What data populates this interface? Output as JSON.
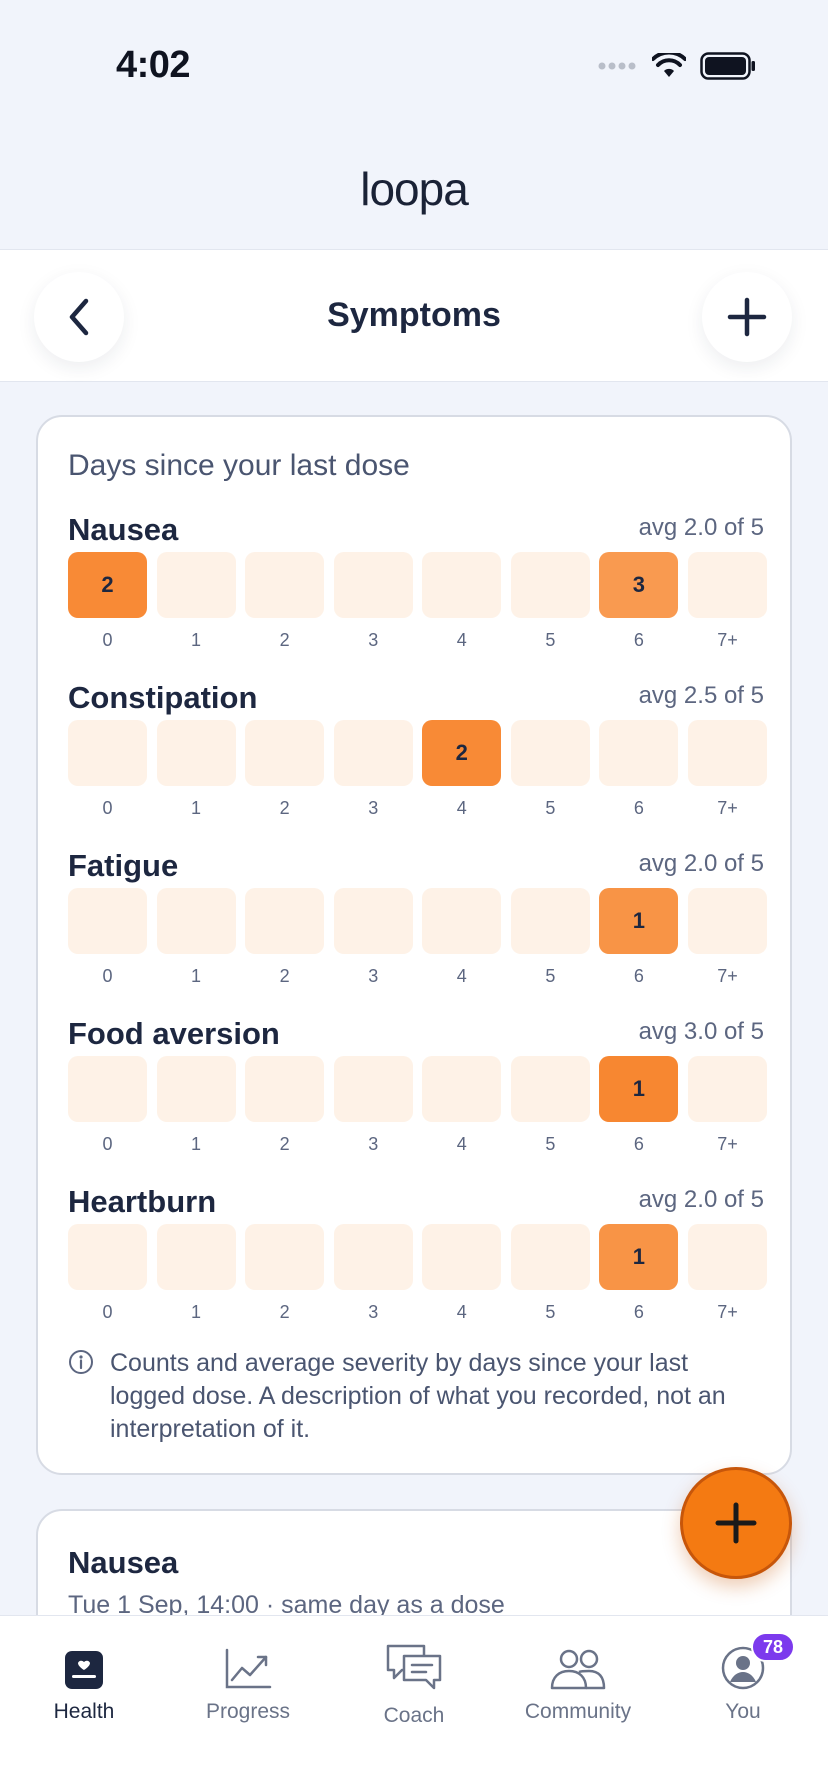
{
  "status_bar": {
    "time": "4:02"
  },
  "app": {
    "logo_text": "loopa"
  },
  "nav": {
    "title": "Symptoms"
  },
  "summary": {
    "title": "Days since your last dose",
    "day_labels": [
      "0",
      "1",
      "2",
      "3",
      "4",
      "5",
      "6",
      "7+"
    ],
    "symptoms": [
      {
        "name": "Nausea",
        "avg": "avg 2.0 of 5",
        "counts": [
          "2",
          "",
          "",
          "",
          "",
          "",
          "3",
          ""
        ],
        "intensity": [
          0.85,
          0,
          0,
          0,
          0,
          0,
          0.6,
          0
        ]
      },
      {
        "name": "Constipation",
        "avg": "avg 2.5 of 5",
        "counts": [
          "",
          "",
          "",
          "",
          "2",
          "",
          "",
          ""
        ],
        "intensity": [
          0,
          0,
          0,
          0,
          0.85,
          0,
          0,
          0
        ]
      },
      {
        "name": "Fatigue",
        "avg": "avg 2.0 of 5",
        "counts": [
          "",
          "",
          "",
          "",
          "",
          "",
          "1",
          ""
        ],
        "intensity": [
          0,
          0,
          0,
          0,
          0,
          0,
          0.7,
          0
        ]
      },
      {
        "name": "Food aversion",
        "avg": "avg 3.0 of 5",
        "counts": [
          "",
          "",
          "",
          "",
          "",
          "",
          "1",
          ""
        ],
        "intensity": [
          0,
          0,
          0,
          0,
          0,
          0,
          0.9,
          0
        ]
      },
      {
        "name": "Heartburn",
        "avg": "avg 2.0 of 5",
        "counts": [
          "",
          "",
          "",
          "",
          "",
          "",
          "1",
          ""
        ],
        "intensity": [
          0,
          0,
          0,
          0,
          0,
          0,
          0.7,
          0
        ]
      }
    ],
    "info_text": "Counts and average severity by days since your last logged dose. A description of what you recorded, not an interpretation of it."
  },
  "log_entry": {
    "title": "Nausea",
    "subtitle": "Tue 1 Sep, 14:00 · same day as a dose"
  },
  "tabs": [
    {
      "label": "Health",
      "icon": "health-icon",
      "active": true
    },
    {
      "label": "Progress",
      "icon": "progress-icon",
      "active": false
    },
    {
      "label": "Coach",
      "icon": "coach-icon",
      "active": false
    },
    {
      "label": "Community",
      "icon": "community-icon",
      "active": false
    },
    {
      "label": "You",
      "icon": "profile-icon",
      "active": false,
      "badge": "78"
    }
  ],
  "colors": {
    "accent": "#f47a12",
    "cell_empty": "#fef2e7",
    "badge": "#7c3aed"
  }
}
